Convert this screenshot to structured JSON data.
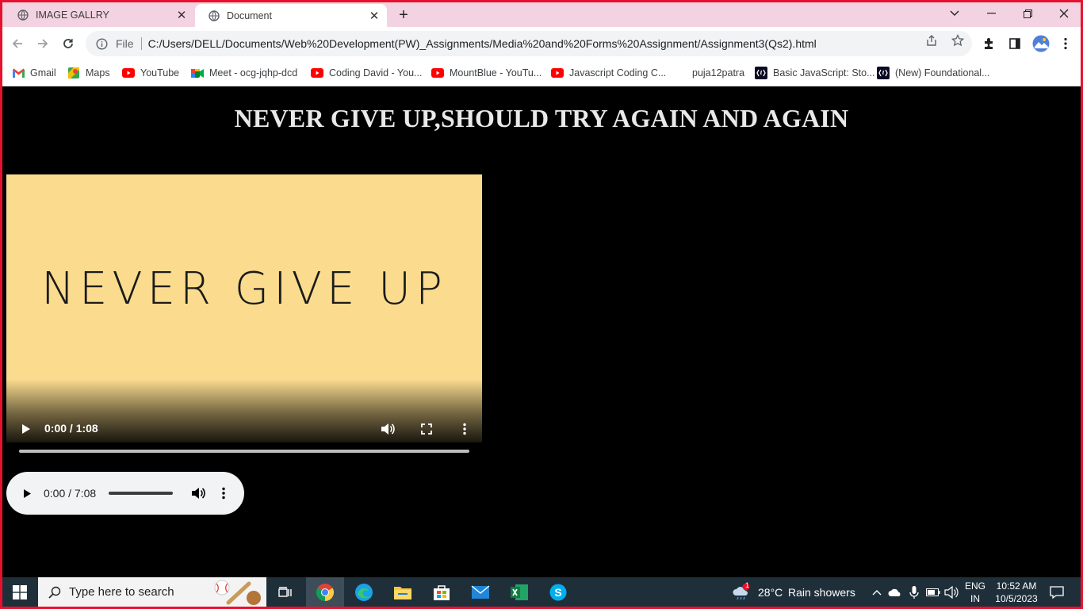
{
  "browser": {
    "tabs": [
      {
        "label": "IMAGE GALLRY",
        "active": false
      },
      {
        "label": "Document",
        "active": true
      }
    ],
    "new_tab_label": "+",
    "address": {
      "scheme_label": "File",
      "url": "C:/Users/DELL/Documents/Web%20Development(PW)_Assignments/Media%20and%20Forms%20Assignment/Assignment3(Qs2).html"
    },
    "bookmarks": [
      {
        "label": "Gmail",
        "icon": "gmail-icon"
      },
      {
        "label": "Maps",
        "icon": "maps-icon"
      },
      {
        "label": "YouTube",
        "icon": "youtube-icon"
      },
      {
        "label": "Meet - ocg-jqhp-dcd",
        "icon": "meet-icon"
      },
      {
        "label": "Coding David - You...",
        "icon": "youtube-icon"
      },
      {
        "label": "MountBlue - YouTu...",
        "icon": "youtube-icon"
      },
      {
        "label": "Javascript Coding C...",
        "icon": "youtube-icon"
      },
      {
        "label": "puja12patra",
        "icon": "none"
      },
      {
        "label": "Basic JavaScript: Sto...",
        "icon": "freecodecamp-icon"
      },
      {
        "label": "(New) Foundational...",
        "icon": "freecodecamp-icon"
      }
    ],
    "colors": {
      "tabstrip": "#f3d3e1",
      "frame_border": "#e8112d"
    }
  },
  "page": {
    "headline": "NEVER GIVE UP,SHOULD TRY AGAIN AND AGAIN",
    "video": {
      "poster_text": "NEVER GIVE UP",
      "time": "0:00 / 1:08",
      "poster_color": "#fbdc8e"
    },
    "audio": {
      "time": "0:00 / 7:08"
    }
  },
  "taskbar": {
    "search_placeholder": "Type here to search",
    "weather": {
      "temp": "28°C",
      "condition": "Rain showers",
      "badge": "1"
    },
    "language": {
      "lang": "ENG",
      "region": "IN"
    },
    "clock": {
      "time": "10:52 AM",
      "date": "10/5/2023"
    },
    "apps": [
      "task-view-icon",
      "chrome-icon",
      "edge-icon",
      "file-explorer-icon",
      "store-icon",
      "mail-icon",
      "excel-icon",
      "skype-icon"
    ]
  }
}
